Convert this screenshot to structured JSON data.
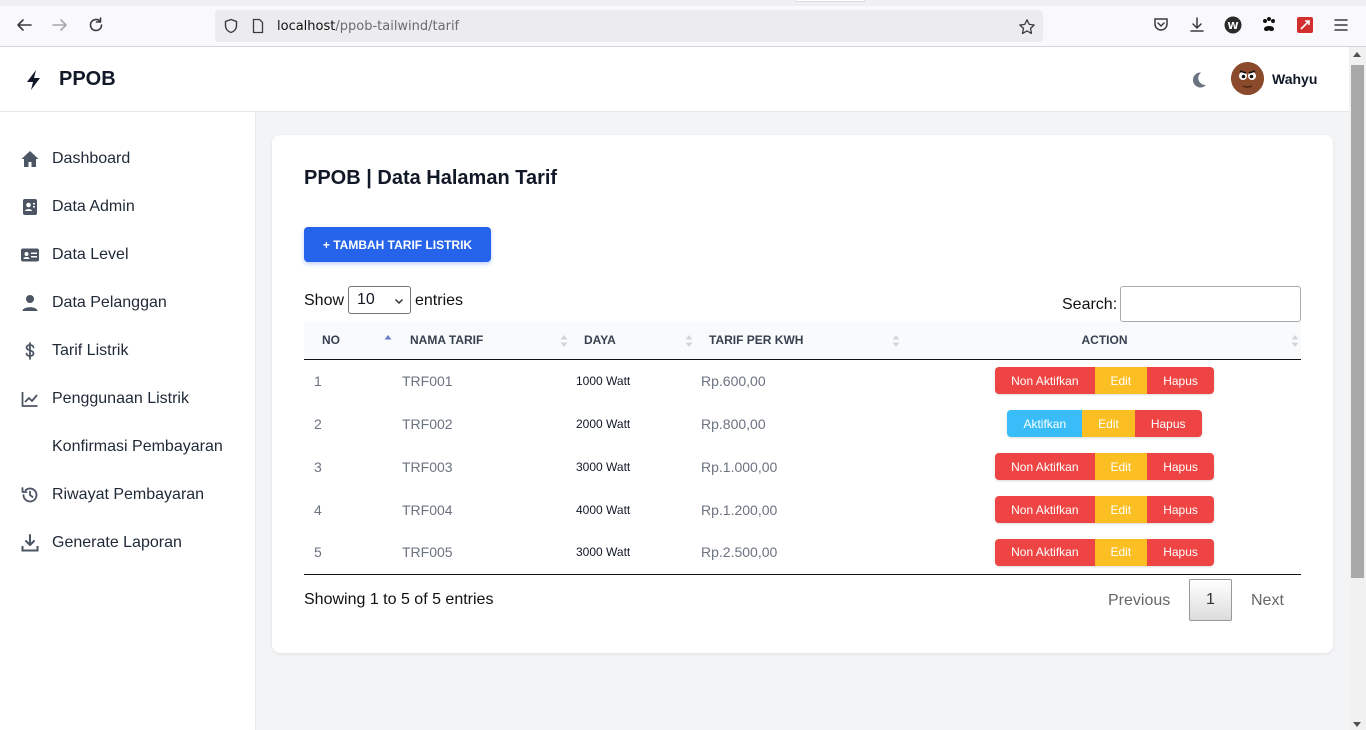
{
  "browser": {
    "url_host": "localhost",
    "url_path": "/ppob-tailwind/tarif"
  },
  "header": {
    "brand": "PPOB",
    "user_name": "Wahyu"
  },
  "sidebar": {
    "items": [
      {
        "label": "Dashboard",
        "icon": "home-icon"
      },
      {
        "label": "Data Admin",
        "icon": "admin-card-icon"
      },
      {
        "label": "Data Level",
        "icon": "id-card-icon"
      },
      {
        "label": "Data Pelanggan",
        "icon": "user-icon"
      },
      {
        "label": "Tarif Listrik",
        "icon": "dollar-icon"
      },
      {
        "label": "Penggunaan Listrik",
        "icon": "line-chart-icon"
      },
      {
        "label": "Konfirmasi Pembayaran",
        "icon": ""
      },
      {
        "label": "Riwayat Pembayaran",
        "icon": "history-icon"
      },
      {
        "label": "Generate Laporan",
        "icon": "download-icon"
      }
    ]
  },
  "main": {
    "title": "PPOB | Data Halaman Tarif",
    "add_button": "+ TAMBAH TARIF LISTRIK",
    "show_label": "Show",
    "entries_value": "10",
    "entries_label": "entries",
    "search_label": "Search:",
    "search_value": "",
    "columns": [
      "NO",
      "NAMA TARIF",
      "DAYA",
      "TARIF PER KWH",
      "ACTION"
    ],
    "rows": [
      {
        "no": "1",
        "nama": "TRF001",
        "daya": "1000 Watt",
        "tarif": "Rp.600,00",
        "status_btn": "Non Aktifkan",
        "status_color": "#ef4444"
      },
      {
        "no": "2",
        "nama": "TRF002",
        "daya": "2000 Watt",
        "tarif": "Rp.800,00",
        "status_btn": "Aktifkan",
        "status_color": "#38bdf8"
      },
      {
        "no": "3",
        "nama": "TRF003",
        "daya": "3000 Watt",
        "tarif": "Rp.1.000,00",
        "status_btn": "Non Aktifkan",
        "status_color": "#ef4444"
      },
      {
        "no": "4",
        "nama": "TRF004",
        "daya": "4000 Watt",
        "tarif": "Rp.1.200,00",
        "status_btn": "Non Aktifkan",
        "status_color": "#ef4444"
      },
      {
        "no": "5",
        "nama": "TRF005",
        "daya": "3000 Watt",
        "tarif": "Rp.2.500,00",
        "status_btn": "Non Aktifkan",
        "status_color": "#ef4444"
      }
    ],
    "edit_label": "Edit",
    "delete_label": "Hapus",
    "info": "Showing 1 to 5 of 5 entries",
    "pagination": {
      "previous": "Previous",
      "current": "1",
      "next": "Next"
    }
  },
  "colors": {
    "primary": "#2563eb",
    "danger": "#ef4444",
    "warning": "#fbbf24",
    "info": "#38bdf8"
  }
}
